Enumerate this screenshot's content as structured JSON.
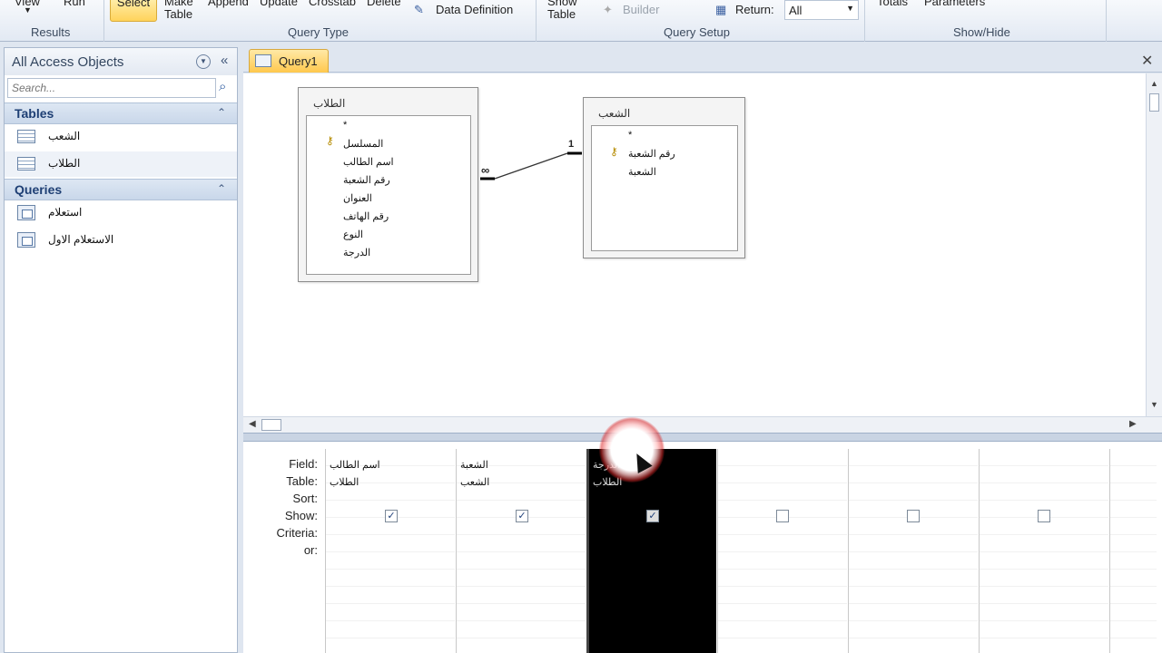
{
  "ribbon": {
    "view_label": "View",
    "run_label": "Run",
    "select_label": "Select",
    "make_table_label_1": "Make",
    "make_table_label_2": "Table",
    "append_label": "Append",
    "update_label": "Update",
    "crosstab_label": "Crosstab",
    "delete_label": "Delete",
    "data_definition_label": "Data Definition",
    "show_table_label_1": "Show",
    "show_table_label_2": "Table",
    "builder_label": "Builder",
    "return_label": "Return:",
    "return_value": "All",
    "totals_label": "Totals",
    "parameters_label": "Parameters",
    "groups": {
      "results": "Results",
      "query_type": "Query Type",
      "query_setup": "Query Setup",
      "show_hide": "Show/Hide"
    }
  },
  "nav": {
    "title": "All Access Objects",
    "search_placeholder": "Search...",
    "sections": [
      {
        "label": "Tables",
        "items": [
          "الشعب",
          "الطلاب"
        ]
      },
      {
        "label": "Queries",
        "items": [
          "استعلام",
          "الاستعلام الاول"
        ]
      }
    ]
  },
  "document": {
    "tab_label": "Query1",
    "tables": [
      {
        "name": "الطلاب",
        "fields": [
          "*",
          "المسلسل",
          "اسم الطالب",
          "رقم الشعبة",
          "العنوان",
          "رقم الهاتف",
          "النوع",
          "الدرجة"
        ],
        "key_field": "المسلسل"
      },
      {
        "name": "الشعب",
        "fields": [
          "*",
          "رقم الشعبة",
          "الشعبة"
        ],
        "key_field": "رقم الشعبة"
      }
    ],
    "relationship": {
      "many": "∞",
      "one": "1"
    }
  },
  "grid": {
    "row_labels": [
      "Field:",
      "Table:",
      "Sort:",
      "Show:",
      "Criteria:",
      "or:"
    ],
    "columns": [
      {
        "field": "اسم الطالب",
        "table": "الطلاب",
        "show": true
      },
      {
        "field": "الشعبة",
        "table": "الشعب",
        "show": true
      },
      {
        "field": "الدرجة",
        "table": "الطلاب",
        "show": true,
        "selected": true
      },
      {
        "field": "",
        "table": "",
        "show": false
      },
      {
        "field": "",
        "table": "",
        "show": false
      },
      {
        "field": "",
        "table": "",
        "show": false
      }
    ]
  }
}
